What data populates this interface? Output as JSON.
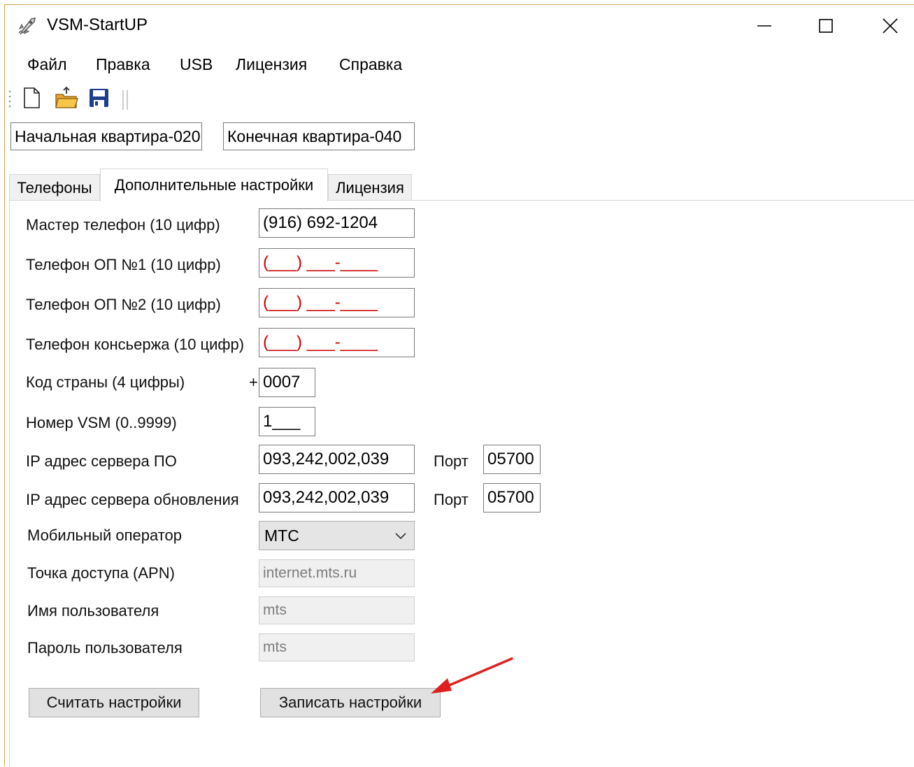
{
  "window": {
    "title": "VSM-StartUP",
    "icons": {
      "app": "rocket-icon",
      "minimize": "minimize-icon",
      "maximize": "maximize-icon",
      "close": "close-icon"
    }
  },
  "menu": [
    "Файл",
    "Правка",
    "USB",
    "Лицензия",
    "Справка"
  ],
  "toolbar": [
    "new-file-icon",
    "open-folder-icon",
    "save-icon"
  ],
  "apartments": {
    "start": "Начальная квартира-020",
    "end": "Конечная квартира-040"
  },
  "tabs": [
    "Телефоны",
    "Дополнительные настройки",
    "Лицензия"
  ],
  "active_tab": "Дополнительные настройки",
  "form": {
    "master_phone": {
      "label": "Мастер телефон (10 цифр)",
      "value": "(916) 692-1204"
    },
    "op1_phone": {
      "label": "Телефон ОП №1 (10 цифр)",
      "value": "(___) ___-____"
    },
    "op2_phone": {
      "label": "Телефон ОП №2 (10 цифр)",
      "value": "(___) ___-____"
    },
    "concierge_phone": {
      "label": "Телефон консьержа (10 цифр)",
      "value": "(___) ___-____"
    },
    "country_code": {
      "label": "Код страны (4 цифры)",
      "prefix": "+",
      "value": "0007"
    },
    "vsm_number": {
      "label": "Номер VSM (0..9999)",
      "value": "1___"
    },
    "server_ip": {
      "label": "IP адрес сервера ПО",
      "value": "093,242,002,039",
      "port_label": "Порт",
      "port": "05700"
    },
    "update_ip": {
      "label": "IP адрес сервера обновления",
      "value": "093,242,002,039",
      "port_label": "Порт",
      "port": "05700"
    },
    "operator": {
      "label": "Мобильный оператор",
      "value": "МТС"
    },
    "apn": {
      "label": "Точка доступа (APN)",
      "value": "internet.mts.ru"
    },
    "username": {
      "label": "Имя пользователя",
      "value": "mts"
    },
    "password": {
      "label": "Пароль пользователя",
      "value": "mts"
    }
  },
  "buttons": {
    "read": "Считать настройки",
    "write": "Записать настройки"
  },
  "colors": {
    "mask_text": "#cc0000",
    "annotation_arrow": "#e02020"
  }
}
